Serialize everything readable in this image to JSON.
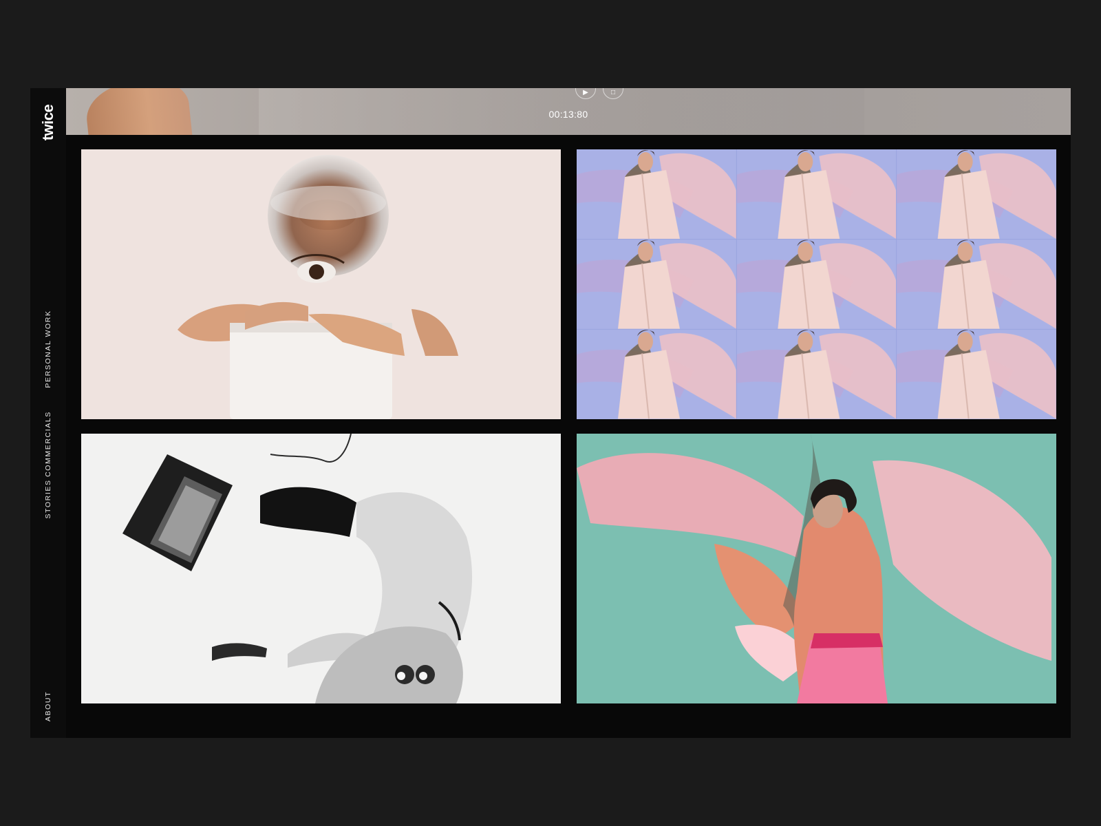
{
  "brand": {
    "logo": "twice"
  },
  "nav": {
    "personal_work": "PERSONAL WORK",
    "commercials": "COMMERCIALS",
    "stories": "STORIES",
    "about": "ABOUT"
  },
  "player": {
    "timecode": "00:13:80",
    "play_icon": "play-icon",
    "fullscreen_icon": "fullscreen-icon"
  },
  "gallery": {
    "tiles": [
      {
        "id": "fishbowl",
        "icon": "photo"
      },
      {
        "id": "pink-suit-grid",
        "icon": "photo"
      },
      {
        "id": "tv-upside-down",
        "icon": "photo"
      },
      {
        "id": "flower-projection",
        "icon": "photo"
      }
    ]
  },
  "colors": {
    "page_background": "#1b1b1b",
    "frame_background": "#080808",
    "text": "#ffffff"
  }
}
